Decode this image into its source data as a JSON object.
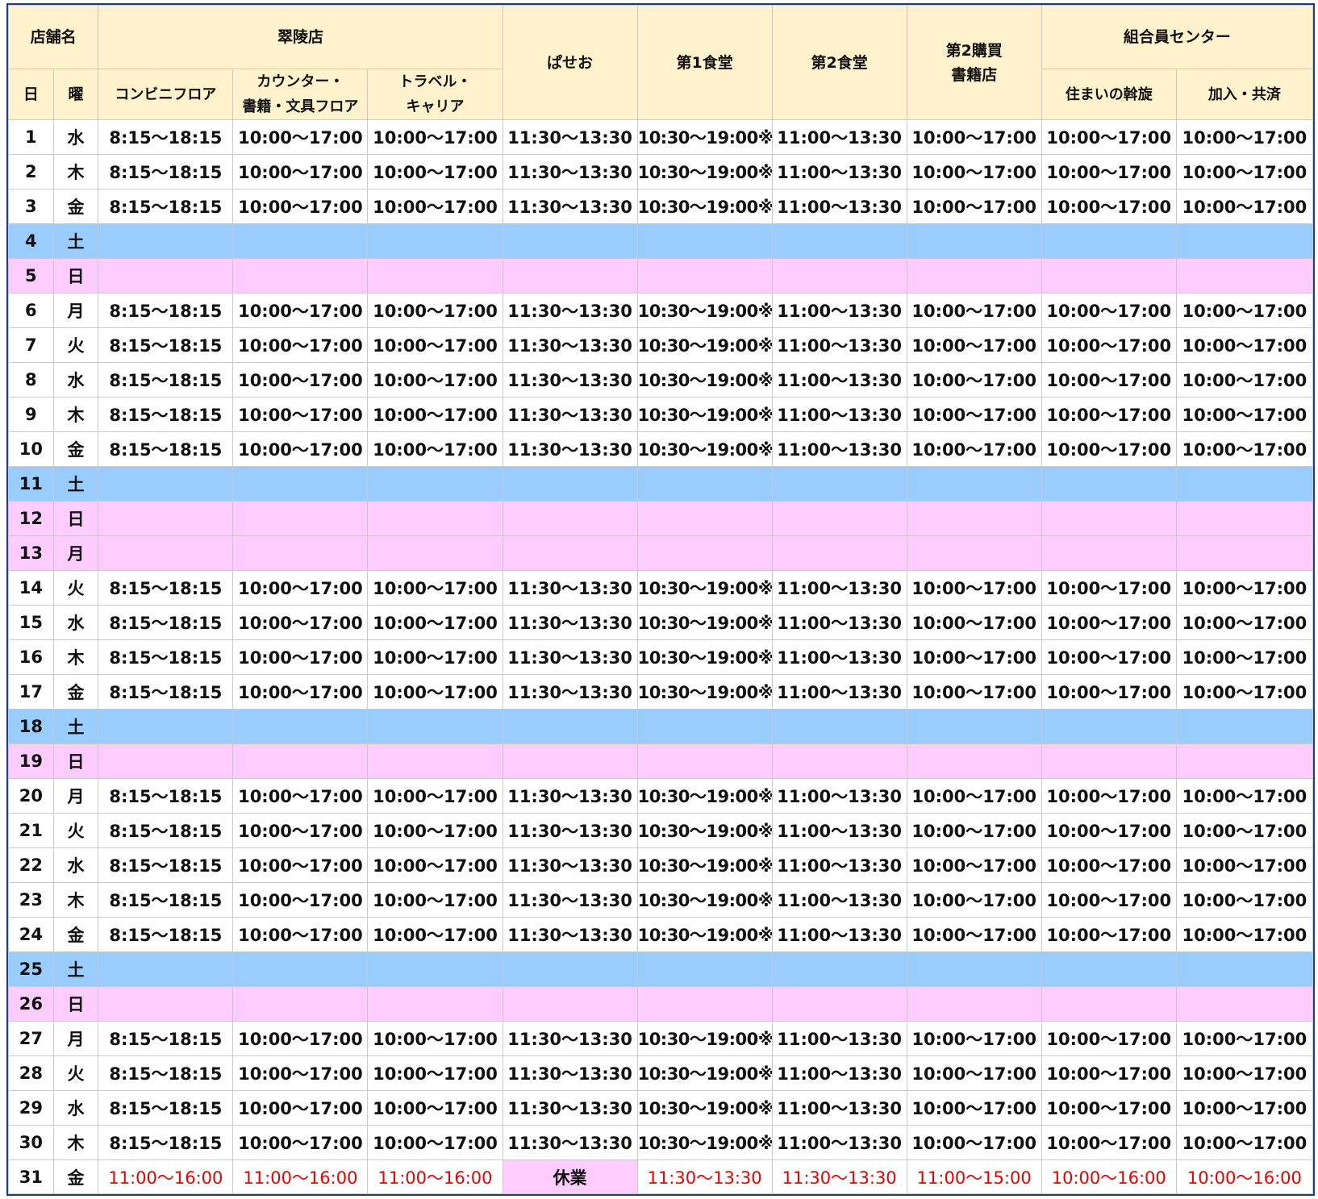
{
  "header": {
    "store_name_label": "店舗名",
    "day_label": "日",
    "weekday_label": "曜",
    "suiryo": "翠陵店",
    "conbini": "コンビニフロア",
    "counter_line1": "カウンター・",
    "counter_line2": "書籍・文具フロア",
    "travel_line1": "トラベル・",
    "travel_line2": "キャリア",
    "paseo": "ぱせお",
    "shokudo1": "第1食堂",
    "shokudo2": "第2食堂",
    "kobai2_line1": "第2購買",
    "kobai2_line2": "書籍店",
    "kumiai": "組合員センター",
    "sumai": "住まいの斡旋",
    "kanyu": "加入・共済"
  },
  "colors": {
    "header_bg": "#fff2cc",
    "saturday_bg": "#99ccff",
    "holiday_bg": "#ffccff",
    "special_text": "#e60000",
    "frame": "#1f3b8c"
  },
  "rows": [
    {
      "day": "1",
      "wd": "水",
      "type": "open"
    },
    {
      "day": "2",
      "wd": "木",
      "type": "open"
    },
    {
      "day": "3",
      "wd": "金",
      "type": "open"
    },
    {
      "day": "4",
      "wd": "土",
      "type": "sat"
    },
    {
      "day": "5",
      "wd": "日",
      "type": "hol"
    },
    {
      "day": "6",
      "wd": "月",
      "type": "open"
    },
    {
      "day": "7",
      "wd": "火",
      "type": "open"
    },
    {
      "day": "8",
      "wd": "水",
      "type": "open"
    },
    {
      "day": "9",
      "wd": "木",
      "type": "open"
    },
    {
      "day": "10",
      "wd": "金",
      "type": "open"
    },
    {
      "day": "11",
      "wd": "土",
      "type": "sat"
    },
    {
      "day": "12",
      "wd": "日",
      "type": "hol"
    },
    {
      "day": "13",
      "wd": "月",
      "type": "hol"
    },
    {
      "day": "14",
      "wd": "火",
      "type": "open"
    },
    {
      "day": "15",
      "wd": "水",
      "type": "open"
    },
    {
      "day": "16",
      "wd": "木",
      "type": "open"
    },
    {
      "day": "17",
      "wd": "金",
      "type": "open"
    },
    {
      "day": "18",
      "wd": "土",
      "type": "sat"
    },
    {
      "day": "19",
      "wd": "日",
      "type": "hol"
    },
    {
      "day": "20",
      "wd": "月",
      "type": "open"
    },
    {
      "day": "21",
      "wd": "火",
      "type": "open"
    },
    {
      "day": "22",
      "wd": "水",
      "type": "open"
    },
    {
      "day": "23",
      "wd": "木",
      "type": "open"
    },
    {
      "day": "24",
      "wd": "金",
      "type": "open"
    },
    {
      "day": "25",
      "wd": "土",
      "type": "sat"
    },
    {
      "day": "26",
      "wd": "日",
      "type": "hol"
    },
    {
      "day": "27",
      "wd": "月",
      "type": "open"
    },
    {
      "day": "28",
      "wd": "火",
      "type": "open"
    },
    {
      "day": "29",
      "wd": "水",
      "type": "open"
    },
    {
      "day": "30",
      "wd": "木",
      "type": "open"
    },
    {
      "day": "31",
      "wd": "金",
      "type": "last"
    }
  ],
  "regular_hours": [
    "8:15～18:15",
    "10:00～17:00",
    "10:00～17:00",
    "11:30～13:30",
    "10:30～19:00※",
    "11:00～13:30",
    "10:00～17:00",
    "10:00～17:00",
    "10:00～17:00"
  ],
  "last_day_hours": [
    "11:00～16:00",
    "11:00～16:00",
    "11:00～16:00",
    "休業",
    "11:30～13:30",
    "11:30～13:30",
    "11:00～15:00",
    "10:00～16:00",
    "10:00～16:00"
  ]
}
